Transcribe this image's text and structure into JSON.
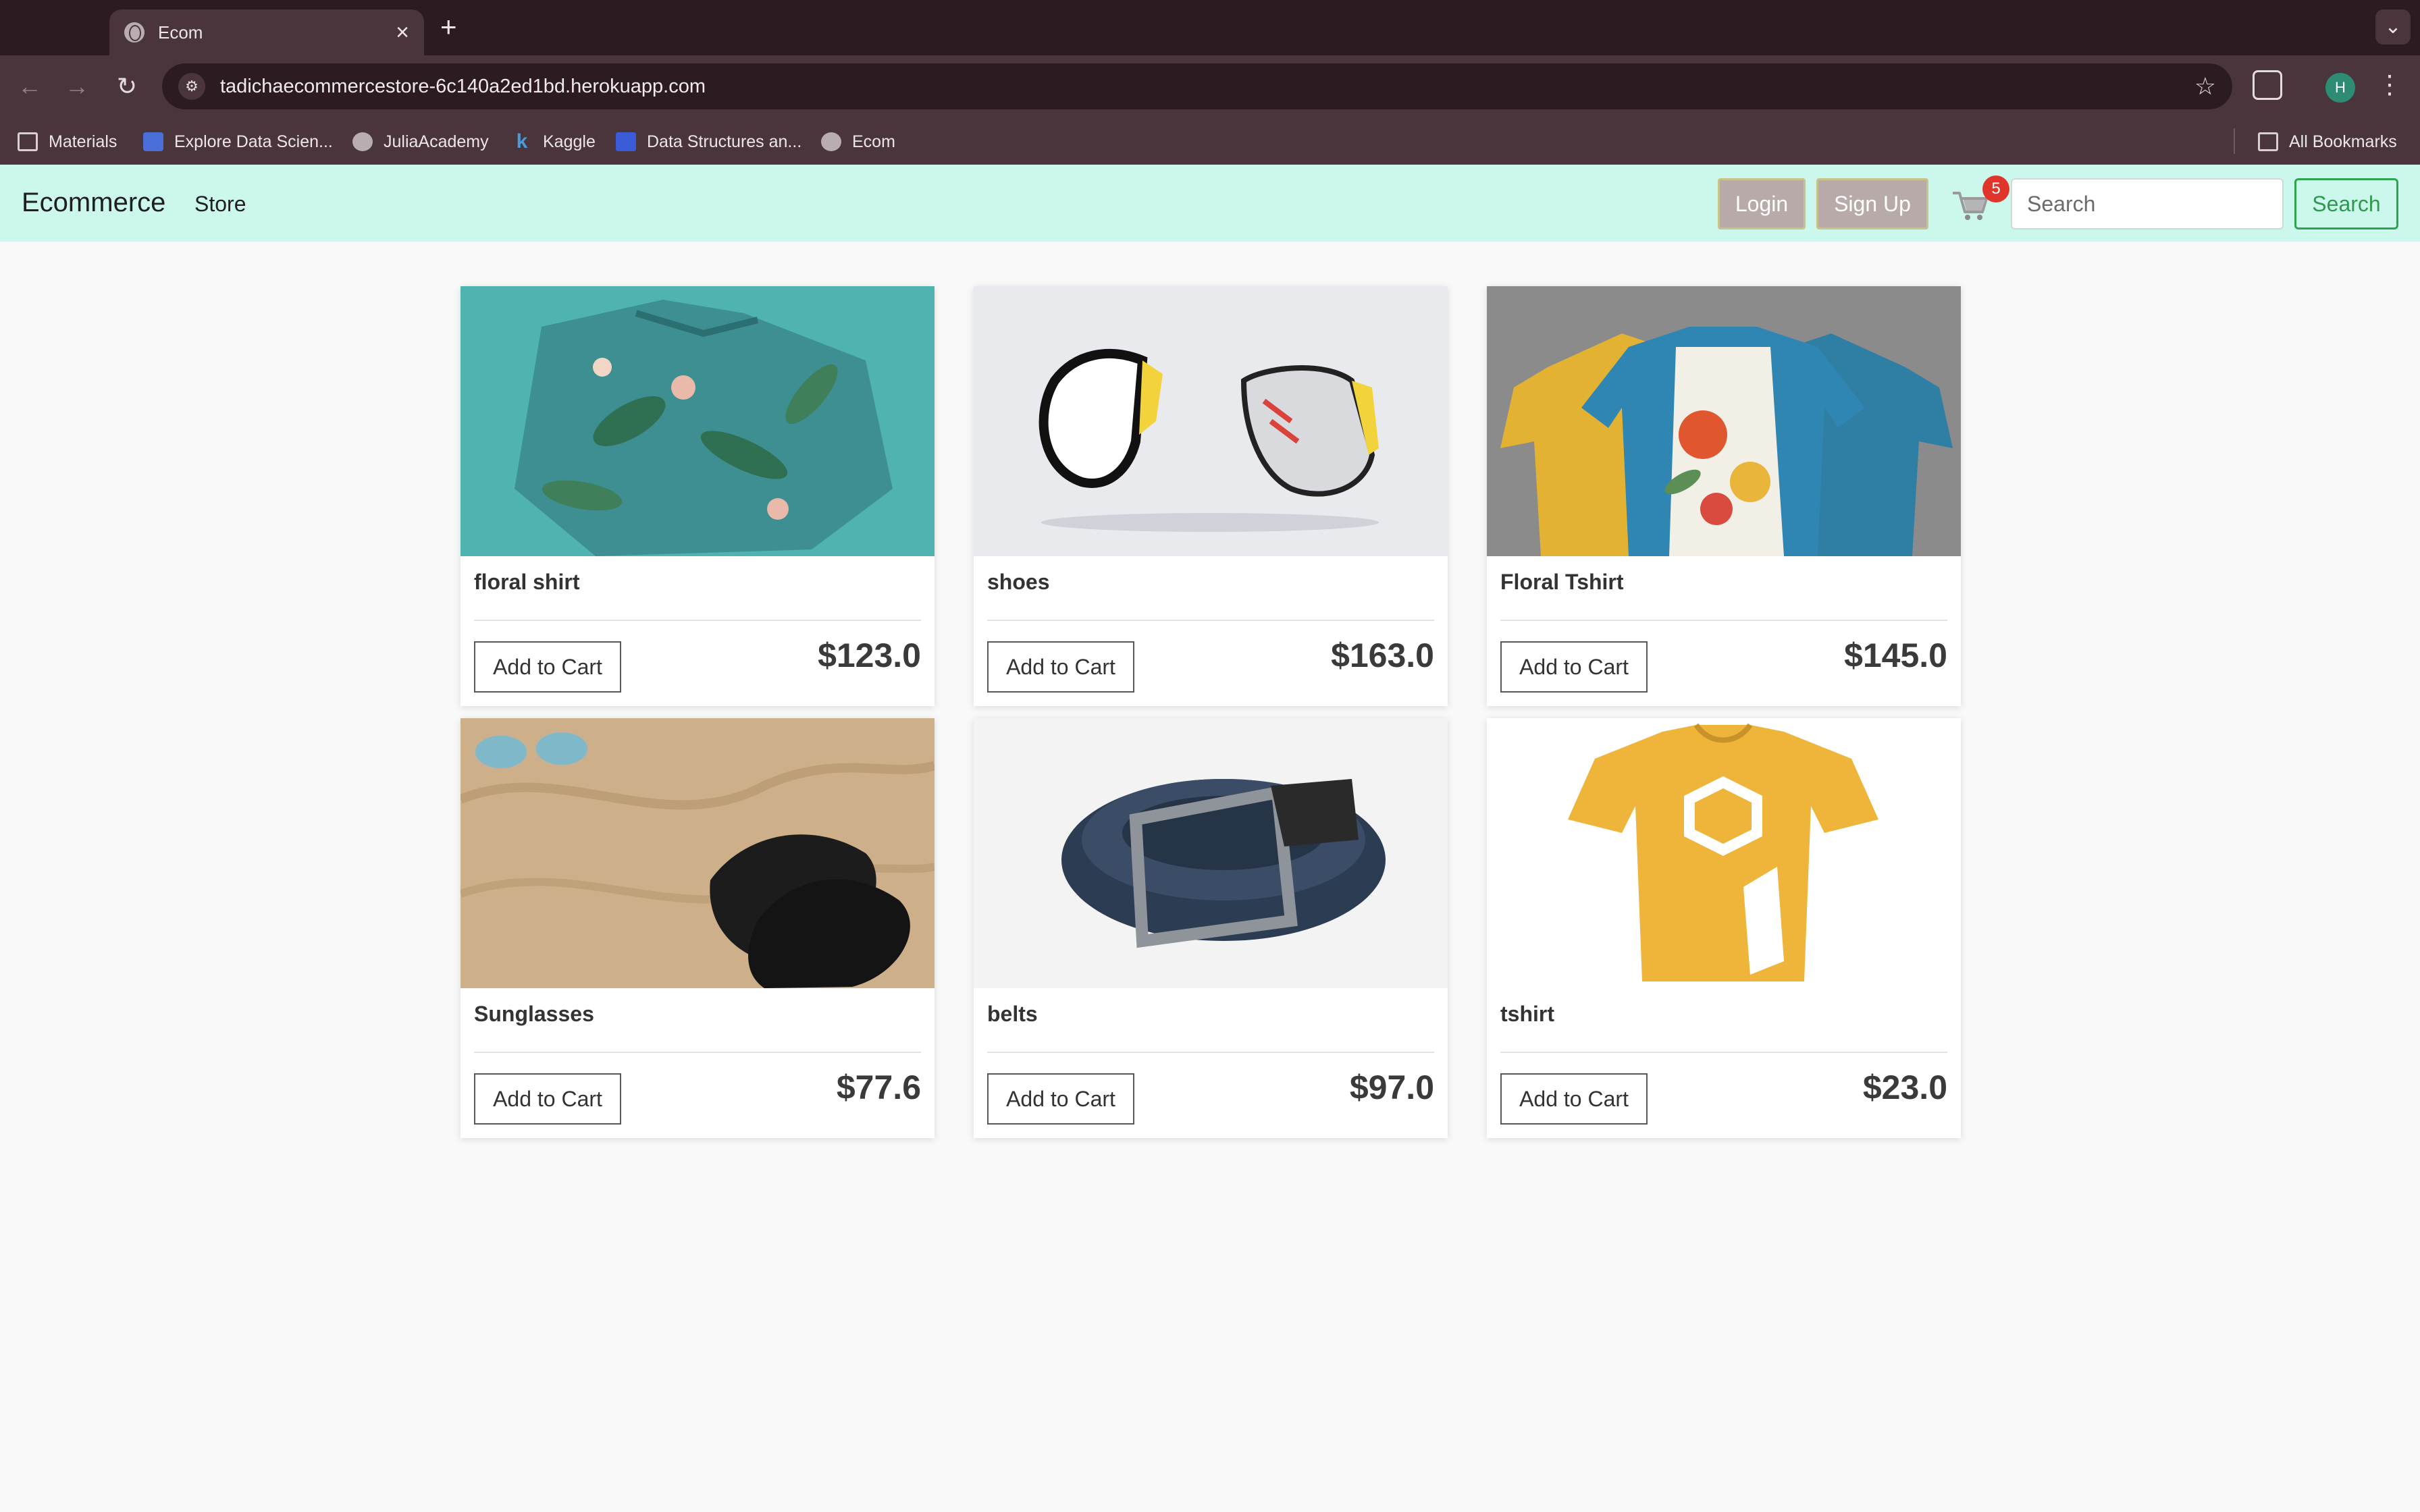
{
  "browser": {
    "tab_title": "Ecom",
    "tab_close": "×",
    "new_tab": "+",
    "url": "tadichaecommercestore-6c140a2ed1bd.herokuapp.com",
    "bookmarks": [
      {
        "label": "Materials",
        "icon": "folder-icon"
      },
      {
        "label": "Explore Data Scien...",
        "icon": "app-icon"
      },
      {
        "label": "JuliaAcademy",
        "icon": "globe-icon"
      },
      {
        "label": "Kaggle",
        "icon": "kaggle-icon"
      },
      {
        "label": "Data Structures an...",
        "icon": "bookmark-icon"
      },
      {
        "label": "Ecom",
        "icon": "globe-icon"
      }
    ],
    "all_bookmarks": "All Bookmarks",
    "profile_initial": "H"
  },
  "navbar": {
    "brand": "Ecommerce",
    "store": "Store",
    "login": "Login",
    "signup": "Sign Up",
    "cart_count": "5",
    "search_placeholder": "Search",
    "search_button": "Search"
  },
  "products": [
    {
      "name": "floral shirt",
      "price": "$123.0",
      "button": "Add to Cart",
      "image": "teal floral shirt"
    },
    {
      "name": "shoes",
      "price": "$163.0",
      "button": "Add to Cart",
      "image": "white sneakers"
    },
    {
      "name": "Floral Tshirt",
      "price": "$145.0",
      "button": "Add to Cart",
      "image": "printed tshirts on hangers"
    },
    {
      "name": "Sunglasses",
      "price": "$77.6",
      "button": "Add to Cart",
      "image": "sunglasses and sandals on sand"
    },
    {
      "name": "belts",
      "price": "$97.0",
      "button": "Add to Cart",
      "image": "rolled woven belt"
    },
    {
      "name": "tshirt",
      "price": "$23.0",
      "button": "Add to Cart",
      "image": "yellow tshirt"
    }
  ],
  "colors": {
    "navbar_bg": "#ccf7ed",
    "search_green": "#2ea44f",
    "badge_red": "#e0352b",
    "chrome_bg": "#2c1c22"
  }
}
